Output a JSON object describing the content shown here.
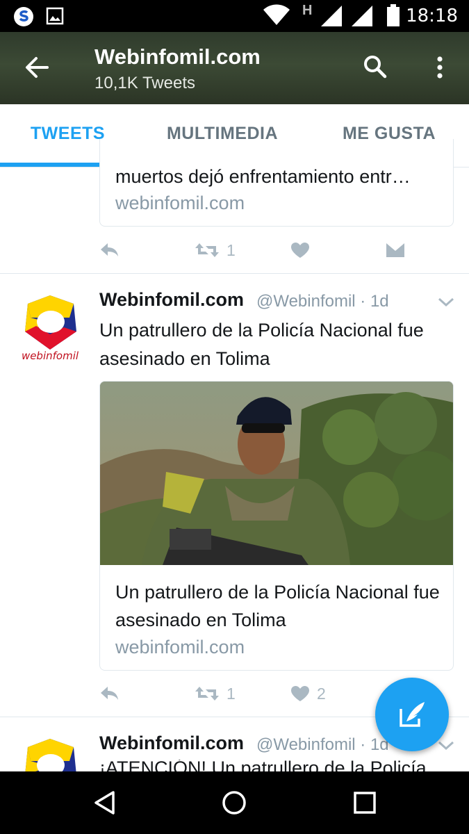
{
  "status_bar": {
    "time": "18:18",
    "network_label": "H",
    "icons": [
      "app-s-icon",
      "image-icon",
      "wifi-icon",
      "signal-icon",
      "signal-icon",
      "battery-icon"
    ]
  },
  "header": {
    "title": "Webinfomil.com",
    "subtitle": "10,1K Tweets",
    "icons": [
      "back-arrow-icon",
      "search-icon",
      "more-vert-icon"
    ]
  },
  "tabs": [
    {
      "label": "TWEETS",
      "active": true
    },
    {
      "label": "MULTIMEDIA",
      "active": false
    },
    {
      "label": "ME GUSTA",
      "active": false
    }
  ],
  "tweets": [
    {
      "card": {
        "text": "muertos dejó enfrentamiento entr…",
        "domain": "webinfomil.com"
      },
      "actions": {
        "retweets": "1",
        "likes": ""
      }
    },
    {
      "name": "Webinfomil.com",
      "meta": "@Webinfomil · 1d",
      "avatar_text": "webinfomil",
      "text": "Un patrullero de la Policía Nacional fue asesinado en Tolima",
      "card": {
        "text": "Un patrullero de la Policía Nacional fue asesinado en Tolima",
        "domain": "webinfomil.com"
      },
      "actions": {
        "retweets": "1",
        "likes": "2"
      }
    },
    {
      "name": "Webinfomil.com",
      "meta": "@Webinfomil · 1d",
      "text": "¡ATENCIÓN! Un patrullero de la Policía"
    }
  ],
  "colors": {
    "accent": "#1da1f2",
    "text": "#14171a",
    "muted": "#8899a6",
    "icon": "#aab8c2"
  }
}
